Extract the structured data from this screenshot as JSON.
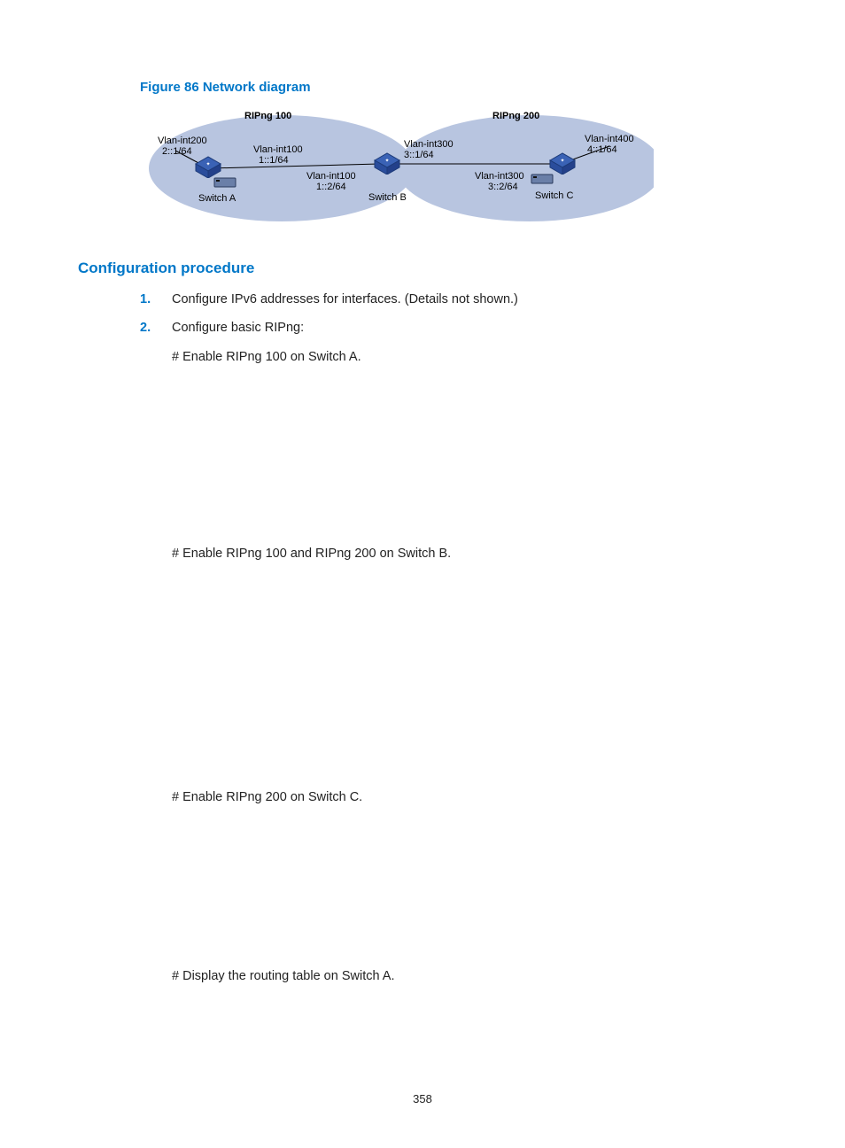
{
  "figure": {
    "caption": "Figure 86 Network diagram",
    "ripng100": "RIPng 100",
    "ripng200": "RIPng 200",
    "labels": {
      "vlan200a": "Vlan-int200",
      "vlan200b": "2::1/64",
      "vlan100la": "Vlan-int100",
      "vlan100lb": "1::1/64",
      "vlan100ra": "Vlan-int100",
      "vlan100rb": "1::2/64",
      "vlan300la": "Vlan-int300",
      "vlan300lb": "3::1/64",
      "vlan300ra": "Vlan-int300",
      "vlan300rb": "3::2/64",
      "vlan400a": "Vlan-int400",
      "vlan400b": "4::1/64",
      "switchA": "Switch A",
      "switchB": "Switch B",
      "switchC": "Switch C"
    }
  },
  "section_heading": "Configuration procedure",
  "steps": {
    "one_num": "1.",
    "one_text": "Configure IPv6 addresses for interfaces. (Details not shown.)",
    "two_num": "2.",
    "two_text": "Configure basic RIPng:"
  },
  "instr": {
    "a": "# Enable RIPng 100 on Switch A.",
    "b": "# Enable RIPng 100 and RIPng 200 on Switch B.",
    "c": "#  Enable RIPng 200 on Switch C.",
    "d": "# Display the routing table on Switch A."
  },
  "page_number": "358"
}
